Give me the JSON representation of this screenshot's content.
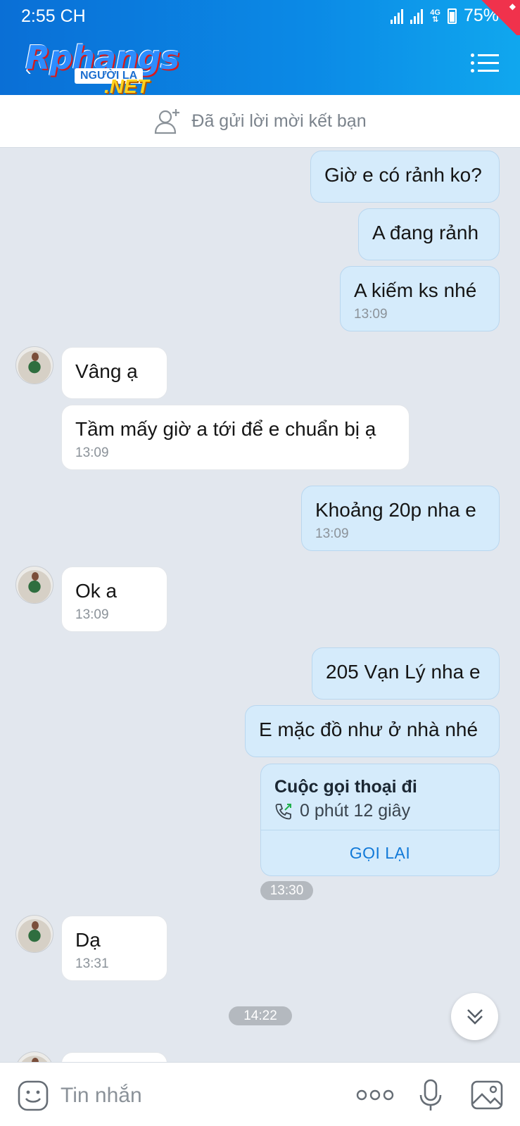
{
  "status_bar": {
    "time": "2:55 CH",
    "network": "4G",
    "battery": "75%"
  },
  "header": {
    "brand": "Rphangs",
    "brand_sub": "NGƯỜI LẠ",
    "brand_net": ".NET"
  },
  "friend_request": {
    "label": "Đã gửi lời mời kết bạn"
  },
  "messages": [
    {
      "dir": "out",
      "text": "Giờ e có rảnh ko?",
      "time": ""
    },
    {
      "dir": "out",
      "text": "A đang rảnh",
      "time": ""
    },
    {
      "dir": "out",
      "text": "A kiếm ks nhé",
      "time": "13:09"
    },
    {
      "dir": "in",
      "text": "Vâng ạ",
      "time": ""
    },
    {
      "dir": "in",
      "text": "Tầm mấy giờ a tới để e chuẩn bị ạ",
      "time": "13:09"
    },
    {
      "dir": "out",
      "text": "Khoảng 20p nha e",
      "time": "13:09"
    },
    {
      "dir": "in",
      "text": "Ok a",
      "time": "13:09"
    },
    {
      "dir": "out",
      "text": "205 Vạn Lý nha e",
      "time": ""
    },
    {
      "dir": "out",
      "text": "E mặc đồ như ở nhà nhé",
      "time": ""
    },
    {
      "dir": "in",
      "text": "Dạ",
      "time": "13:31"
    }
  ],
  "call": {
    "title": "Cuộc gọi thoại đi",
    "duration": "0 phút 12 giây",
    "callback_label": "GỌI LẠI",
    "time": "13:30"
  },
  "separator_time": "14:22",
  "input": {
    "placeholder": "Tin nhắn"
  },
  "colors": {
    "header_blue": "#0b8ae6",
    "outgoing_bubble": "#d5ebfb",
    "incoming_bubble": "#ffffff",
    "chat_background": "#e2e7ee",
    "accent": "#1179d8"
  }
}
